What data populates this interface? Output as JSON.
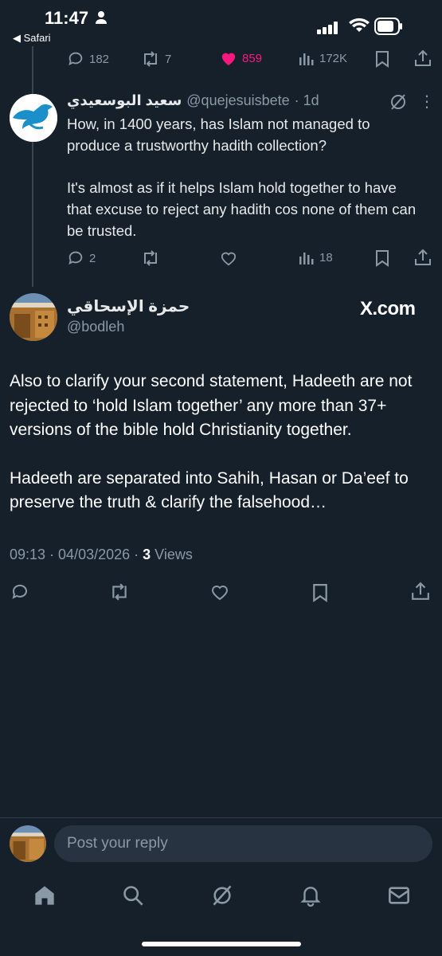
{
  "status_bar": {
    "time": "11:47",
    "back_label": "◀ Safari"
  },
  "prev_tweet_actions": {
    "replies": "182",
    "reposts": "7",
    "likes": "859",
    "views": "172K",
    "like_color": "#f91880"
  },
  "reply_tweet": {
    "name": "سعيد البوسعيدي",
    "handle": "@quejesuisbete",
    "time": "· 1d",
    "paragraphs": [
      "How, in 1400 years, has Islam not managed to produce a trustworthy hadith collection?",
      "It's almost as if it helps Islam hold together to have that excuse to reject any hadith cos none of them can be trusted."
    ],
    "actions": {
      "replies": "2",
      "views": "18"
    }
  },
  "main_tweet": {
    "name": "حمزة الإسحاقي",
    "handle": "@bodleh",
    "source": "X.com",
    "paragraphs": [
      "Also to clarify your second statement, Hadeeth are not rejected to ‘hold Islam together’ any more than 37+ versions of the bible hold Christianity together.",
      "Hadeeth are separated into Sahih, Hasan or Da’eef to preserve the truth & clarify the falsehood…"
    ],
    "timestamp": "09:13 · 04/03/2026 · ",
    "views_count": "3",
    "views_label": " Views"
  },
  "reply_box": {
    "placeholder": "Post your reply"
  },
  "bottom_nav": [
    "home-icon",
    "search-icon",
    "grok-icon",
    "notifications-icon",
    "messages-icon"
  ],
  "colors": {
    "background": "#15202b",
    "muted": "#8b98a5"
  }
}
